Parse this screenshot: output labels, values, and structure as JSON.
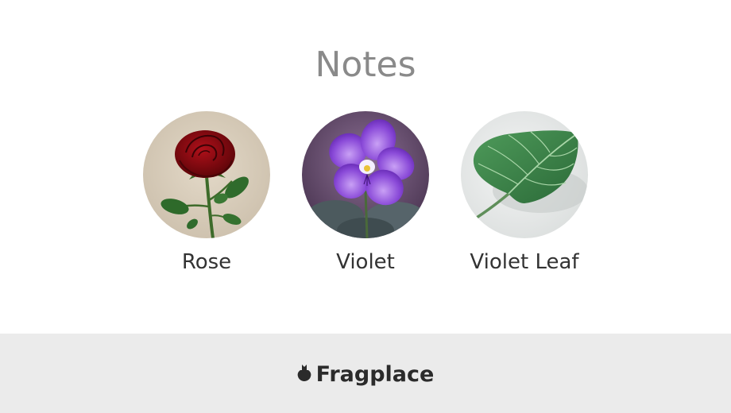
{
  "notes_section": {
    "heading": "Notes",
    "items": [
      {
        "label": "Rose",
        "icon": "rose-image"
      },
      {
        "label": "Violet",
        "icon": "violet-image"
      },
      {
        "label": "Violet Leaf",
        "icon": "violet-leaf-image"
      }
    ]
  },
  "footer": {
    "brand_name": "Fragplace",
    "logo_icon": "fragplace-logo-icon",
    "background": "#ebebeb"
  },
  "colors": {
    "heading": "#8a8a8a",
    "label": "#333333",
    "brand": "#2b2b2b"
  }
}
